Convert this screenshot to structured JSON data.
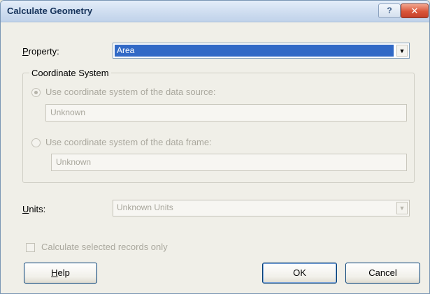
{
  "window": {
    "title": "Calculate Geometry",
    "help_glyph": "?",
    "close_glyph": "✕"
  },
  "property": {
    "label": "Property:",
    "label_accel": "P",
    "label_rest": "roperty:",
    "value": "Area"
  },
  "coordinate_system": {
    "legend": "Coordinate System",
    "option_data_source": {
      "label": "Use coordinate system of the data source:",
      "checked": true,
      "value": "Unknown"
    },
    "option_data_frame": {
      "label": "Use coordinate system of the data frame:",
      "checked": false,
      "value": "Unknown"
    }
  },
  "units": {
    "label": "Units:",
    "label_accel": "U",
    "label_rest": "nits:",
    "value": "Unknown Units"
  },
  "selected_only": {
    "label": "Calculate selected records only",
    "checked": false
  },
  "buttons": {
    "help_accel": "H",
    "help_rest": "elp",
    "ok": "OK",
    "cancel": "Cancel"
  },
  "icons": {
    "dropdown": "chevron-down-icon"
  }
}
